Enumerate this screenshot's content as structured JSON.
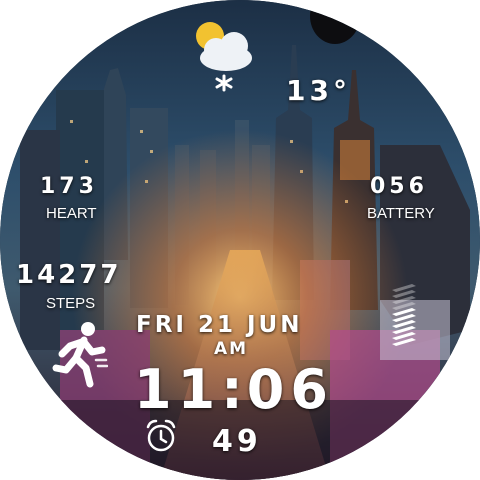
{
  "weather": {
    "icon": "partly-cloudy-snow-icon",
    "temperature": "13°"
  },
  "heart": {
    "value": "173",
    "label": "HEART"
  },
  "battery": {
    "value": "056",
    "label": "BATTERY",
    "level_percent": 56
  },
  "steps": {
    "value": "14277",
    "label": "STEPS",
    "icon": "running-person-icon"
  },
  "date": {
    "text": "FRI 21 JUN"
  },
  "time": {
    "ampm": "AM",
    "hours": "11",
    "minutes": "06",
    "seconds": "49"
  },
  "alarm": {
    "icon": "alarm-clock-icon"
  },
  "colors": {
    "text": "#ffffff",
    "sky": "#2b4a66",
    "glow": "#ff9a3c",
    "neon": "#c2449a"
  }
}
